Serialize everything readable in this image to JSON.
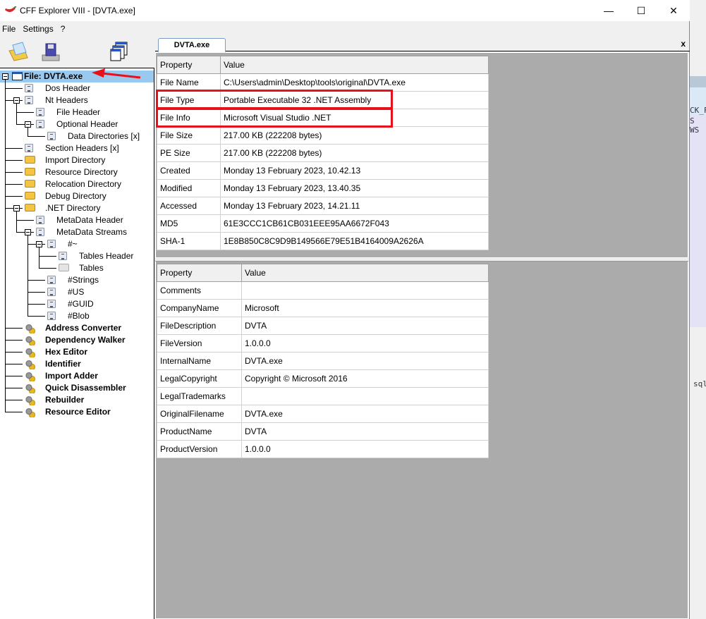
{
  "window": {
    "title": "CFF Explorer VIII - [DVTA.exe]",
    "minimize": "—",
    "maximize": "☐",
    "close": "✕"
  },
  "menu": [
    "File",
    "Settings",
    "?"
  ],
  "toolbar": [
    {
      "icon": "open-folder-icon"
    },
    {
      "icon": "save-disk-icon"
    },
    {
      "icon": "windows-icon"
    }
  ],
  "tree": [
    {
      "label": "File: DVTA.exe",
      "level": 0,
      "icon": "file",
      "expanded": true,
      "selected": true,
      "bold": true
    },
    {
      "label": "Dos Header",
      "level": 1,
      "icon": "doc"
    },
    {
      "label": "Nt Headers",
      "level": 1,
      "icon": "doc",
      "expanded": true
    },
    {
      "label": "File Header",
      "level": 2,
      "icon": "doc"
    },
    {
      "label": "Optional Header",
      "level": 2,
      "icon": "doc",
      "expanded": true
    },
    {
      "label": "Data Directories [x]",
      "level": 3,
      "icon": "doc"
    },
    {
      "label": "Section Headers [x]",
      "level": 1,
      "icon": "doc"
    },
    {
      "label": "Import Directory",
      "level": 1,
      "icon": "folder"
    },
    {
      "label": "Resource Directory",
      "level": 1,
      "icon": "folder"
    },
    {
      "label": "Relocation Directory",
      "level": 1,
      "icon": "folder"
    },
    {
      "label": "Debug Directory",
      "level": 1,
      "icon": "folder"
    },
    {
      "label": ".NET Directory",
      "level": 1,
      "icon": "folder",
      "expanded": true
    },
    {
      "label": "MetaData Header",
      "level": 2,
      "icon": "doc"
    },
    {
      "label": "MetaData Streams",
      "level": 2,
      "icon": "doc",
      "expanded": true
    },
    {
      "label": "#~",
      "level": 3,
      "icon": "doc",
      "expanded": true
    },
    {
      "label": "Tables Header",
      "level": 4,
      "icon": "doc"
    },
    {
      "label": "Tables",
      "level": 4,
      "icon": "folder-open"
    },
    {
      "label": "#Strings",
      "level": 3,
      "icon": "doc"
    },
    {
      "label": "#US",
      "level": 3,
      "icon": "doc"
    },
    {
      "label": "#GUID",
      "level": 3,
      "icon": "doc"
    },
    {
      "label": "#Blob",
      "level": 3,
      "icon": "doc"
    },
    {
      "label": "Address Converter",
      "level": 1,
      "icon": "gear",
      "bold": true
    },
    {
      "label": "Dependency Walker",
      "level": 1,
      "icon": "gear",
      "bold": true
    },
    {
      "label": "Hex Editor",
      "level": 1,
      "icon": "gear",
      "bold": true
    },
    {
      "label": "Identifier",
      "level": 1,
      "icon": "gear",
      "bold": true
    },
    {
      "label": "Import Adder",
      "level": 1,
      "icon": "gear",
      "bold": true
    },
    {
      "label": "Quick Disassembler",
      "level": 1,
      "icon": "gear",
      "bold": true
    },
    {
      "label": "Rebuilder",
      "level": 1,
      "icon": "gear",
      "bold": true
    },
    {
      "label": "Resource Editor",
      "level": 1,
      "icon": "gear",
      "bold": true
    }
  ],
  "tab": {
    "label": "DVTA.exe",
    "close": "x"
  },
  "file_table": {
    "headers": [
      "Property",
      "Value"
    ],
    "rows": [
      [
        "File Name",
        "C:\\Users\\admin\\Desktop\\tools\\original\\DVTA.exe"
      ],
      [
        "File Type",
        "Portable Executable 32 .NET Assembly"
      ],
      [
        "File Info",
        "Microsoft Visual Studio .NET"
      ],
      [
        "File Size",
        "217.00 KB (222208 bytes)"
      ],
      [
        "PE Size",
        "217.00 KB (222208 bytes)"
      ],
      [
        "Created",
        "Monday 13 February 2023, 10.42.13"
      ],
      [
        "Modified",
        "Monday 13 February 2023, 13.40.35"
      ],
      [
        "Accessed",
        "Monday 13 February 2023, 14.21.11"
      ],
      [
        "MD5",
        "61E3CCC1CB61CB031EEE95AA6672F043"
      ],
      [
        "SHA-1",
        "1E8B850C8C9D9B149566E79E51B4164009A2626A"
      ]
    ]
  },
  "version_table": {
    "headers": [
      "Property",
      "Value"
    ],
    "rows": [
      [
        "Comments",
        ""
      ],
      [
        "CompanyName",
        "Microsoft"
      ],
      [
        "FileDescription",
        "DVTA"
      ],
      [
        "FileVersion",
        "1.0.0.0"
      ],
      [
        "InternalName",
        "DVTA.exe"
      ],
      [
        "LegalCopyright",
        "Copyright © Microsoft 2016"
      ],
      [
        "LegalTrademarks",
        ""
      ],
      [
        "OriginalFilename",
        "DVTA.exe"
      ],
      [
        "ProductName",
        "DVTA"
      ],
      [
        "ProductVersion",
        "1.0.0.0"
      ]
    ]
  },
  "annotations": {
    "color": "#e8101a",
    "highlighted_rows": [
      "File Type",
      "File Info"
    ],
    "arrow_target": "File: DVTA.exe"
  },
  "background_window": {
    "fragments": [
      "CK_F",
      "S WS",
      "sql"
    ]
  }
}
